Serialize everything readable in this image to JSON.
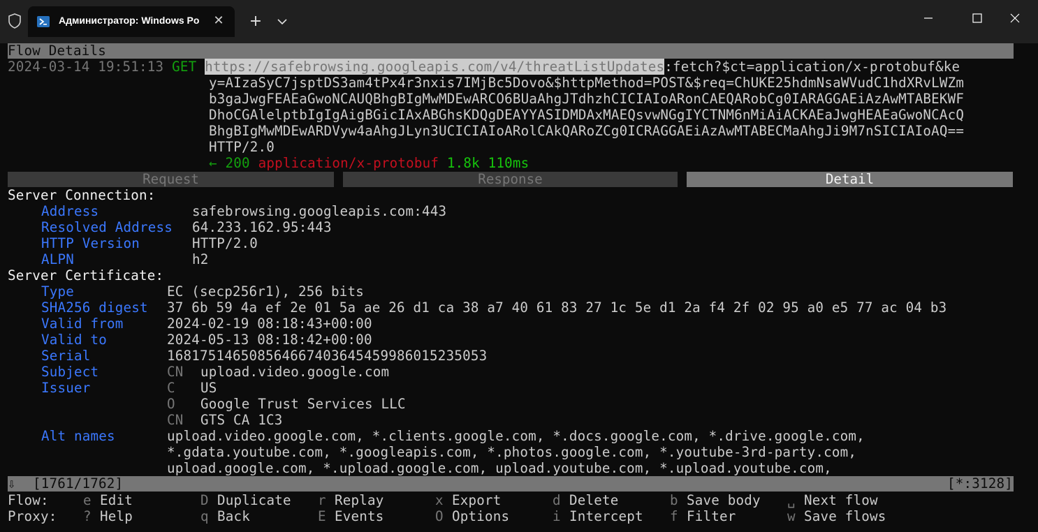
{
  "window": {
    "tab_title": "Администратор: Windows Po",
    "new_tab": "+",
    "colors": {
      "titlebar": "#202020",
      "terminal_bg": "#0c0c0c",
      "bar": "#767676",
      "key_blue": "#3b78ff",
      "green": "#13a10e",
      "red": "#c50f1f"
    }
  },
  "header": {
    "title": "Flow Details"
  },
  "flow": {
    "timestamp": "2024-03-14 19:51:13",
    "method": "GET",
    "url_lines": [
      "https://safebrowsing.googleapis.com/v4/threatListUpdates",
      ":fetch?$ct=application/x-protobuf&ke",
      "y=AIzaSyC7jsptDS3am4tPx4r3nxis7IMjBc5Dovo&$httpMethod=POST&$req=ChUKE25hdmNsaWVudC1hdXRvLWZm",
      "b3gaJwgFEAEaGwoNCAUQBhgBIgMwMDEwARCO6BUaAhgJTdhzhCICIAIoARonCAEQARobCg0IARAGGAEiAzAwMTABEKWF",
      "DhoCGAlelptbIgIgAigBGicIAxABGhsKDQgDEAYYASIDMDAxMAEQsvwNGgIYCTNM6nMiAiACKAEaJwgHEAEaGwoNCAcQ",
      "BhgBIgMwMDEwARDVyw4aAhgJLyn3UCICIAIoARolCAkQARoZCg0ICRAGGAEiAzAwMTABECMaAhgJi9M7nSICIAIoAQ=="
    ],
    "http_version": "HTTP/2.0",
    "arrow": "←",
    "status": "200",
    "content_type": "application/x-protobuf",
    "size": "1.8k",
    "time": "110ms"
  },
  "tabs": {
    "request": "Request",
    "response": "Response",
    "detail": "Detail"
  },
  "server_connection": {
    "heading": "Server Connection:",
    "rows": [
      {
        "key": "Address",
        "value": "safebrowsing.googleapis.com:443"
      },
      {
        "key": "Resolved Address",
        "value": "64.233.162.95:443"
      },
      {
        "key": "HTTP Version",
        "value": "HTTP/2.0"
      },
      {
        "key": "ALPN",
        "value": "h2"
      }
    ]
  },
  "server_certificate": {
    "heading": "Server Certificate:",
    "type": {
      "key": "Type",
      "value": "EC (secp256r1), 256 bits"
    },
    "sha": {
      "key": "SHA256 digest",
      "value": "37 6b 59 4a ef 2e 01 5a ae 26 d1 ca 38 a7 40 61 83 27 1c 5e d1 2a f4 2f 02 95 a0 e5 77 ac 04 b3"
    },
    "valid_from": {
      "key": "Valid from",
      "value": "2024-02-19 08:18:43+00:00"
    },
    "valid_to": {
      "key": "Valid to",
      "value": "2024-05-13 08:18:42+00:00"
    },
    "serial": {
      "key": "Serial",
      "value": "168175146508564667403645459986015235053"
    },
    "subject": {
      "key": "Subject",
      "cn_label": "CN",
      "cn_value": "upload.video.google.com"
    },
    "issuer": {
      "key": "Issuer",
      "c_label": "C",
      "c_value": "US",
      "o_label": "O",
      "o_value": "Google Trust Services LLC",
      "cn_label": "CN",
      "cn_value": "GTS CA 1C3"
    },
    "alt_names": {
      "key": "Alt names",
      "lines": [
        "upload.video.google.com, *.clients.google.com, *.docs.google.com, *.drive.google.com,",
        "*.gdata.youtube.com, *.googleapis.com, *.photos.google.com, *.youtube-3rd-party.com,",
        "upload.google.com, *.upload.google.com, upload.youtube.com, *.upload.youtube.com,"
      ]
    }
  },
  "statusbar": {
    "arrow": "⇩",
    "position": "[1761/1762]",
    "listen": "[*:3128]"
  },
  "keybar": {
    "flow_label": "Flow:",
    "proxy_label": "Proxy:",
    "flow_keys": [
      {
        "key": "e",
        "label": "Edit"
      },
      {
        "key": "D",
        "label": "Duplicate"
      },
      {
        "key": "r",
        "label": "Replay"
      },
      {
        "key": "x",
        "label": "Export"
      },
      {
        "key": "d",
        "label": "Delete"
      },
      {
        "key": "b",
        "label": "Save body"
      },
      {
        "key": "␣",
        "label": "Next flow"
      }
    ],
    "proxy_keys": [
      {
        "key": "?",
        "label": "Help"
      },
      {
        "key": "q",
        "label": "Back"
      },
      {
        "key": "E",
        "label": "Events"
      },
      {
        "key": "O",
        "label": "Options"
      },
      {
        "key": "i",
        "label": "Intercept"
      },
      {
        "key": "f",
        "label": "Filter"
      },
      {
        "key": "w",
        "label": "Save flows"
      }
    ]
  }
}
